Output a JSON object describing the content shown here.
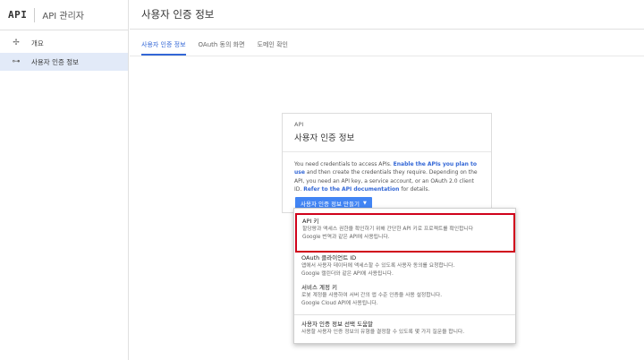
{
  "sidebar": {
    "logo": "API",
    "app_name": "API 관리자",
    "items": [
      {
        "icon": "overview-icon",
        "label": "개요"
      },
      {
        "icon": "key-icon",
        "label": "사용자 인증 정보"
      }
    ]
  },
  "header": {
    "title": "사용자 인증 정보"
  },
  "tabs": [
    {
      "label": "사용자 인증 정보"
    },
    {
      "label": "OAuth 동의 화면"
    },
    {
      "label": "도메인 확인"
    }
  ],
  "card": {
    "eyebrow": "API",
    "title": "사용자 인증 정보",
    "desc_1": "You need credentials to access APIs. ",
    "link_1": "Enable the APIs you plan to use",
    "desc_2": " and then create the credentials they require. Depending on the API, you need an API key, a service account, or an OAuth 2.0 client ID. ",
    "link_2": "Refer to the API documentation",
    "desc_3": " for details.",
    "button_label": "사용자 인증 정보 만들기"
  },
  "dropdown": {
    "api_key": {
      "name": "API 키",
      "line_1": "할당량과 액세스 권한을 확인하기 위해 간단한 API 키로 프로젝트를 확인합니다",
      "line_2": "Google 번역과 같은 API에 사용됩니다."
    },
    "oauth": {
      "name": "OAuth 클라이언트 ID",
      "line_1": "앱에서 사용자 데이터에 액세스할 수 있도록 사용자 동의를 요청합니다.",
      "line_2": "Google 캘린더와 같은 API에 사용됩니다."
    },
    "service": {
      "name": "서비스 계정 키",
      "line_1": "로봇 계정을 사용하여 서버 간의 앱 수준 인증을 사용 설정합니다.",
      "line_2": "Google Cloud API에 사용됩니다."
    },
    "wizard": {
      "name": "사용자 인증 정보 선택 도움말",
      "line_1": "사용할 사용자 인증 정보의 유형을 결정할 수 있도록 몇 가지 질문을 합니다."
    }
  },
  "colors": {
    "accent": "#4285f4",
    "link": "#3367d6",
    "highlight": "#d0021b",
    "nav_active": "#e2eaf8"
  }
}
